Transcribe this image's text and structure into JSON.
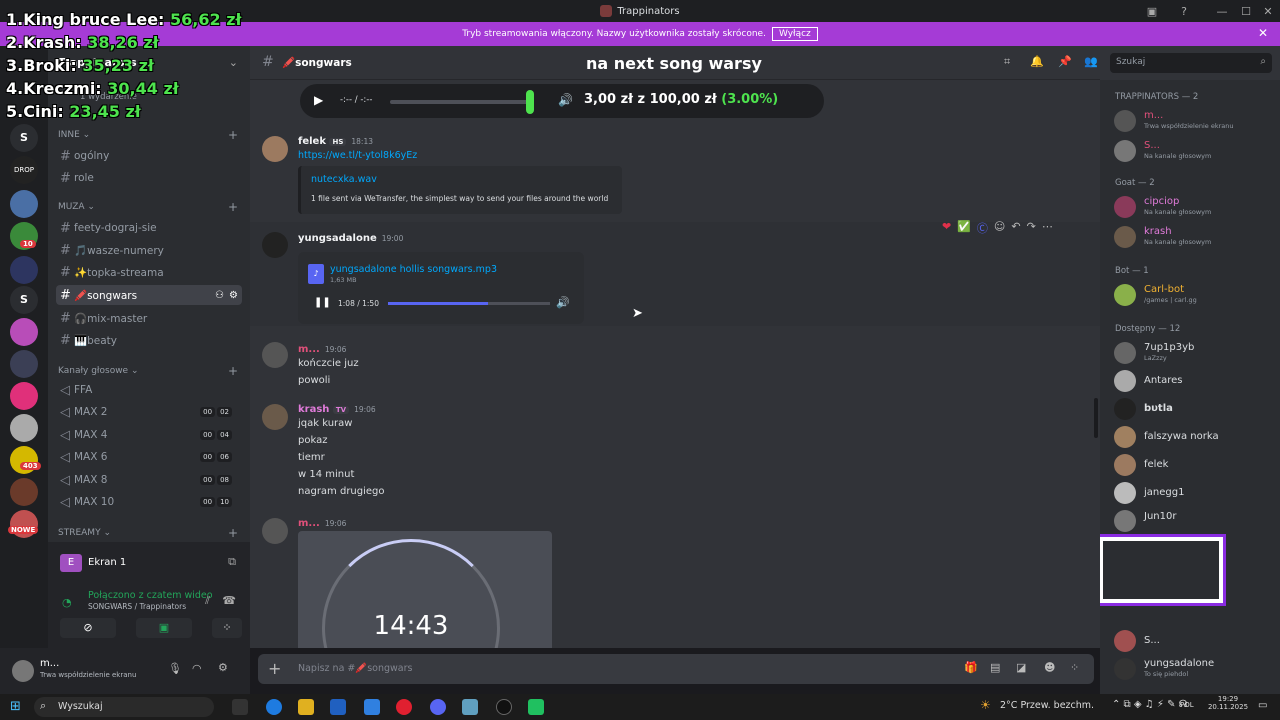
{
  "window": {
    "title": "Trappinators"
  },
  "banner": {
    "text": "Tryb streamowania włączony. Nazwy użytkownika zostały skrócone.",
    "button": "Wyłącz"
  },
  "overlay": {
    "lines": [
      {
        "label": "1.King bruce Lee:",
        "value": "56,62 zł"
      },
      {
        "label": "2.Krash:",
        "value": "38,26 zł"
      },
      {
        "label": "3.Broki:",
        "value": "35,23 zł"
      },
      {
        "label": "4.Kreczmi:",
        "value": "30,44 zł"
      },
      {
        "label": "5.Cini:",
        "value": "23,45 zł"
      }
    ]
  },
  "server": {
    "name": "Trappinators",
    "events": "1 wydarzenie"
  },
  "guild_badges": [
    "10",
    "403",
    "NOWE"
  ],
  "guild_letters": [
    "S",
    "S"
  ],
  "categories": {
    "inne": "INNE",
    "muza": "MUZA",
    "voice": "Kanały głosowe",
    "streamy": "STREAMY"
  },
  "channels_inne": [
    "ogólny",
    "role"
  ],
  "channels_muza": [
    "feety-dograj-sie",
    "🎵wasze-numery",
    "✨topka-streama",
    "🖍️songwars",
    "🎧mix-master",
    "🎹beaty"
  ],
  "voice_channels": [
    {
      "name": "FFA"
    },
    {
      "name": "MAX 2",
      "a": "00",
      "b": "02"
    },
    {
      "name": "MAX 4",
      "a": "00",
      "b": "04"
    },
    {
      "name": "MAX 6",
      "a": "00",
      "b": "06"
    },
    {
      "name": "MAX 8",
      "a": "00",
      "b": "08"
    },
    {
      "name": "MAX 10",
      "a": "00",
      "b": "10"
    }
  ],
  "stream_panel": {
    "title": "Ekran 1",
    "status": "Połączono z czatem wideo",
    "location": "SONGWARS / Trappinators"
  },
  "user_panel": {
    "name": "m...",
    "status": "Trwa współdzielenie ekranu"
  },
  "header": {
    "channel": "🖍️songwars",
    "overlay_title": "na next song warsy",
    "search_placeholder": "Szukaj"
  },
  "player_top": {
    "time": "-:-- / -:--",
    "donation_amount": "3,00 zł",
    "donation_goal": "z 100,00 zł",
    "donation_pct": "(3.00%)"
  },
  "messages": [
    {
      "author": "felek",
      "tag": "HS",
      "time": "18:13",
      "link": "https://we.tl/t-ytol8k6yEz",
      "embed_title": "nutecxka.wav",
      "embed_desc": "1 file sent via WeTransfer, the simplest way to send your files around the world"
    },
    {
      "author": "yungsadalone",
      "time": "19:00",
      "file": "yungsadalone hollis songwars.mp3",
      "size": "1,63 MB",
      "progress": "1:08 / 1:50"
    },
    {
      "author": "m...",
      "time": "19:06",
      "lines": [
        "kończcie juz",
        "powoli"
      ]
    },
    {
      "author": "krash",
      "tag": "TV",
      "time": "19:06",
      "lines": [
        "jqak kuraw",
        "pokaz",
        "tiemr",
        "w 14 minut",
        "nagram drugiego"
      ]
    },
    {
      "author": "m...",
      "time": "19:06",
      "timer": "14:43"
    }
  ],
  "composer": {
    "placeholder": "Napisz na #🖍️songwars"
  },
  "members": {
    "groups": [
      {
        "title": "TRAPPINATORS — 2",
        "items": [
          {
            "name": "m...",
            "status": "Trwa współdzielenie ekranu",
            "color": "#e0507a"
          },
          {
            "name": "S...",
            "status": "Na kanale głosowym",
            "color": "#e0507a"
          }
        ]
      },
      {
        "title": "Goat — 2",
        "items": [
          {
            "name": "cipciop",
            "status": "Na kanale głosowym",
            "color": "#e07bd9"
          },
          {
            "name": "krash",
            "status": "Na kanale głosowym",
            "color": "#e07bd9"
          }
        ]
      },
      {
        "title": "Bot — 1",
        "items": [
          {
            "name": "Carl-bot",
            "status": "/games | carl.gg",
            "color": "#f0b132"
          }
        ]
      },
      {
        "title": "Dostępny — 12",
        "items": [
          {
            "name": "7up1p3yb",
            "status": "LaZzzy",
            "color": "#dbdee1"
          },
          {
            "name": "Antares",
            "status": "",
            "color": "#dbdee1"
          },
          {
            "name": "bυtla",
            "status": "",
            "color": "#dbdee1"
          },
          {
            "name": "falszywa norka",
            "status": "",
            "color": "#dbdee1"
          },
          {
            "name": "felek",
            "status": "",
            "color": "#dbdee1"
          },
          {
            "name": "janegg1",
            "status": "",
            "color": "#dbdee1"
          },
          {
            "name": "Jun10r",
            "status": "",
            "color": "#dbdee1"
          },
          {
            "name": "S...",
            "status": "",
            "color": "#dbdee1"
          },
          {
            "name": "yungsadalone",
            "status": "To się piehdol",
            "color": "#dbdee1"
          }
        ]
      }
    ]
  },
  "taskbar": {
    "search": "Wyszukaj",
    "weather": "2°C  Przew. bezchm.",
    "time": "19:29",
    "date": "20.11.2025",
    "lang": "POL"
  }
}
